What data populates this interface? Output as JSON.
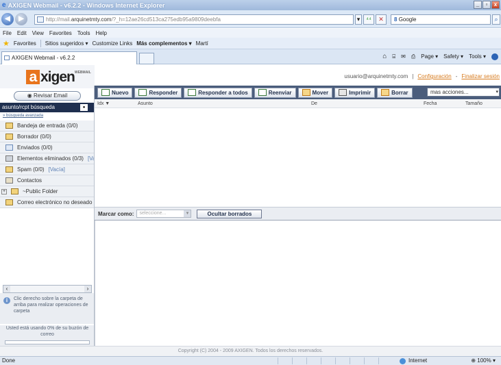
{
  "window": {
    "title": "AXIGEN Webmail - v6.2.2 - Windows Internet Explorer",
    "minimize_glyph": "_",
    "restore_glyph": "▫",
    "close_glyph": "x"
  },
  "address_bar": {
    "url_prefix": "http://mail.",
    "url_domain": "arquinetmty.com",
    "url_rest": "/?_h=12ae26cd513ca275edb95a9809deebfa",
    "back_glyph": "◀",
    "forward_glyph": "▶",
    "refresh_glyph": "⁴⁴",
    "stop_glyph": "✕",
    "search_engine_logo": "8",
    "search_placeholder": "Google",
    "search_glyph": "⌕"
  },
  "menu": [
    "File",
    "Edit",
    "View",
    "Favorites",
    "Tools",
    "Help"
  ],
  "favorites_bar": {
    "favorites_label": "Favorites",
    "items": [
      "Sitios sugeridos ▾",
      "Customize Links",
      "Más complementos ▾",
      "Martí"
    ]
  },
  "ie_tab": {
    "label": "AXIGEN Webmail - v6.2.2"
  },
  "ie_tools": {
    "items": [
      "Page ▾",
      "Safety ▾",
      "Tools ▾"
    ],
    "home_glyph": "⌂",
    "feeds_glyph": "⌸",
    "mail_glyph": "✉",
    "print_glyph": "⎙"
  },
  "webmail": {
    "logo_letter": "a",
    "logo_text": "xigen",
    "logo_sup": "WEBMAIL",
    "user_email": "usuario@arquinetmty.com",
    "config_link": "Configuración",
    "logout_link": "Finalizar sesión",
    "check_mail_button": "Revisar Email",
    "search_label": "asunto/rcpt búsqueda",
    "advanced_search": "» búsqueda avanzada",
    "toolbar": [
      "Nuevo",
      "Responder",
      "Responder a todos",
      "Reenviar",
      "Mover",
      "Imprimir",
      "Borrar"
    ],
    "more_actions": "mas acciones...",
    "folders": [
      {
        "label": "Bandeja de entrada (0/0)",
        "extra": ""
      },
      {
        "label": "Borrador (0/0)",
        "extra": ""
      },
      {
        "label": "Enviados (0/0)",
        "extra": ""
      },
      {
        "label": "Elementos eliminados (0/3)",
        "extra": "[Va"
      },
      {
        "label": "Spam (0/0)",
        "extra": "[Vacía]"
      },
      {
        "label": "Contactos",
        "extra": ""
      },
      {
        "label": "~Public Folder",
        "extra": ""
      },
      {
        "label": "Correo electrónico no deseado",
        "extra": ""
      }
    ],
    "list_headers": {
      "idx": "Idx ▼",
      "subject": "Asunto",
      "from": "De",
      "date": "Fecha",
      "size": "Tamaño"
    },
    "mark_as_label": "Marcar como:",
    "mark_as_select": "seleccione...",
    "hide_deleted_button": "Ocultar borrados",
    "info_text": "Clic derecho sobre la carpeta de arriba para realizar operaciones de carpeta",
    "quota_text": "Usted está usando 0% de su buzón de correo",
    "quota_percent": 0,
    "footer": "Copyright (C) 2004 - 2009 AXIGEN. Todos los derechos reservados."
  },
  "statusbar": {
    "left": "Done",
    "zone": "Internet",
    "zoom": "100%"
  }
}
